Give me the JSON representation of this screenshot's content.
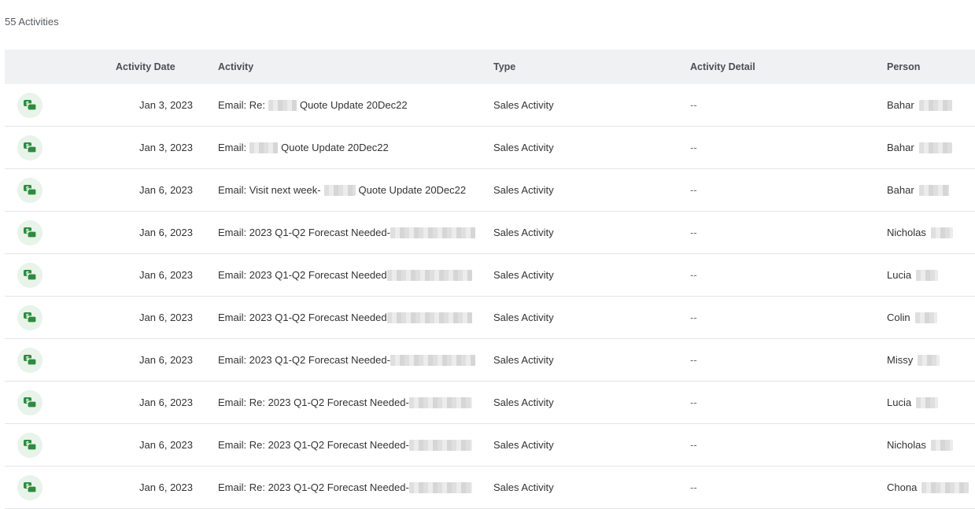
{
  "summary": {
    "count_label": "55 Activities"
  },
  "columns": {
    "activity_date": "Activity Date",
    "activity": "Activity",
    "type": "Type",
    "activity_detail": "Activity Detail",
    "person": "Person"
  },
  "icon": {
    "name": "sales-activity-icon",
    "color": "#2e8b3e",
    "bg": "#e8f3ea"
  },
  "rows": [
    {
      "date": "Jan 3, 2023",
      "activity_pre": "Email: Re:",
      "activity_post": "Quote Update 20Dec22",
      "type": "Sales Activity",
      "detail": "--",
      "person": "Bahar"
    },
    {
      "date": "Jan 3, 2023",
      "activity_pre": "Email:",
      "activity_post": "Quote Update 20Dec22",
      "type": "Sales Activity",
      "detail": "--",
      "person": "Bahar"
    },
    {
      "date": "Jan 6, 2023",
      "activity_pre": "Email: Visit next week-",
      "activity_post": "Quote Update 20Dec22",
      "type": "Sales Activity",
      "detail": "--",
      "person": "Bahar"
    },
    {
      "date": "Jan 6, 2023",
      "activity_pre": "Email: 2023 Q1-Q2 Forecast Needed-",
      "activity_post": "",
      "type": "Sales Activity",
      "detail": "--",
      "person": "Nicholas"
    },
    {
      "date": "Jan 6, 2023",
      "activity_pre": "Email: 2023 Q1-Q2 Forecast Needed",
      "activity_post": "",
      "type": "Sales Activity",
      "detail": "--",
      "person": "Lucia"
    },
    {
      "date": "Jan 6, 2023",
      "activity_pre": "Email: 2023 Q1-Q2 Forecast Needed",
      "activity_post": "",
      "type": "Sales Activity",
      "detail": "--",
      "person": "Colin"
    },
    {
      "date": "Jan 6, 2023",
      "activity_pre": "Email: 2023 Q1-Q2 Forecast Needed-",
      "activity_post": "",
      "type": "Sales Activity",
      "detail": "--",
      "person": "Missy"
    },
    {
      "date": "Jan 6, 2023",
      "activity_pre": "Email: Re: 2023 Q1-Q2 Forecast Needed-",
      "activity_post": "",
      "type": "Sales Activity",
      "detail": "--",
      "person": "Lucia"
    },
    {
      "date": "Jan 6, 2023",
      "activity_pre": "Email: Re: 2023 Q1-Q2 Forecast Needed-",
      "activity_post": "",
      "type": "Sales Activity",
      "detail": "--",
      "person": "Nicholas"
    },
    {
      "date": "Jan 6, 2023",
      "activity_pre": "Email: Re: 2023 Q1-Q2 Forecast Needed-",
      "activity_post": "",
      "type": "Sales Activity",
      "detail": "--",
      "person": "Chona"
    }
  ]
}
